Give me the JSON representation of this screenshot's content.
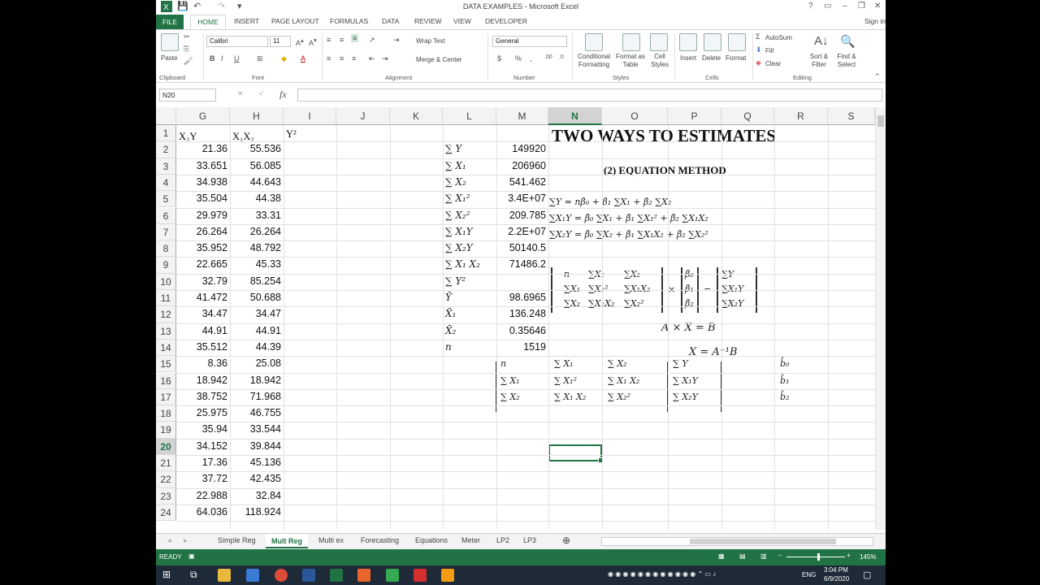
{
  "window": {
    "title": "DATA EXAMPLES - Microsoft Excel"
  },
  "menu_tabs": [
    "FILE",
    "HOME",
    "INSERT",
    "PAGE LAYOUT",
    "FORMULAS",
    "DATA",
    "REVIEW",
    "VIEW",
    "DEVELOPER"
  ],
  "signin": "Sign in",
  "ribbon": {
    "paste": "Paste",
    "font_name": "Calibri",
    "font_size": "11",
    "wrap_text": "Wrap Text",
    "merge_center": "Merge & Center",
    "number_format": "General",
    "cond_format": "Conditional Formatting",
    "format_table": "Format as Table",
    "cell_styles": "Cell Styles",
    "insert": "Insert",
    "delete": "Delete",
    "format": "Format",
    "autosum": "AutoSum",
    "fill": "Fill",
    "clear": "Clear",
    "sort_filter": "Sort & Filter",
    "find_select": "Find & Select",
    "groups": [
      "Clipboard",
      "Font",
      "Alignment",
      "Number",
      "Styles",
      "Cells",
      "Editing"
    ]
  },
  "namebox": "N20",
  "columns": [
    "G",
    "H",
    "I",
    "J",
    "K",
    "L",
    "M",
    "N",
    "O",
    "P",
    "Q",
    "R",
    "S"
  ],
  "selected_column": "N",
  "rows": [
    "1",
    "2",
    "3",
    "4",
    "5",
    "6",
    "7",
    "8",
    "9",
    "10",
    "11",
    "12",
    "13",
    "14",
    "15",
    "16",
    "17",
    "18",
    "19",
    "20",
    "21",
    "22",
    "23",
    "24"
  ],
  "selected_row": "20",
  "headers": {
    "g1": "X₂Y",
    "h1": "X₁X₂",
    "i1": "Y²"
  },
  "col_g": [
    "21.36",
    "33.651",
    "34.938",
    "35.504",
    "29.979",
    "26.264",
    "35.952",
    "22.665",
    "32.79",
    "41.472",
    "34.47",
    "44.91",
    "35.512",
    "8.36",
    "18.942",
    "38.752",
    "25.975",
    "35.94",
    "34.152",
    "17.36",
    "37.72",
    "22.988",
    "64.036"
  ],
  "col_h": [
    "55.536",
    "56.085",
    "44.643",
    "44.38",
    "33.31",
    "26.264",
    "48.792",
    "45.33",
    "85.254",
    "50.688",
    "34.47",
    "44.91",
    "44.39",
    "25.08",
    "18.942",
    "71.968",
    "46.755",
    "33.544",
    "39.844",
    "45.136",
    "42.435",
    "32.84",
    "118.924"
  ],
  "col_l": [
    "∑ Y",
    "∑ X₁",
    "∑ X₂",
    "∑ X₁²",
    "∑ X₂²",
    "∑ X₁Y",
    "∑ X₂Y",
    "∑ X₁ X₂",
    "∑ Y²",
    "Ȳ",
    "X̄₁",
    "X̄₂",
    "n"
  ],
  "col_m": [
    "149920",
    "206960",
    "541.462",
    "3.4E+07",
    "209.785",
    "2.2E+07",
    "50140.5",
    "71486.2",
    "",
    "98.6965",
    "136.248",
    "0.35646",
    "1519"
  ],
  "title": "TWO WAYS TO ESTIMATES",
  "subtitle": "(2) EQUATION METHOD",
  "equations": [
    "∑Y = nβ̂₀ + β̂₁ ∑X₁ + β̂₂ ∑X₂",
    "∑X₁Y = β̂₀ ∑X₁ + β̂₁ ∑X₁² + β̂₂ ∑X₁X₂",
    "∑X₂Y = β̂₀ ∑X₂ + β̂₁ ∑X₁X₂ + β̂₂ ∑X₂²"
  ],
  "matrix_a": [
    [
      "n",
      "∑X₁",
      "∑X₂"
    ],
    [
      "∑X₁",
      "∑X₁²",
      "∑X₁X₂"
    ],
    [
      "∑X₂",
      "∑X₁X₂",
      "∑X₂²"
    ]
  ],
  "vector_beta": [
    "β̂₀",
    "β̂₁",
    "β̂₂"
  ],
  "vector_b": [
    "∑Y",
    "∑X₁Y",
    "∑X₂Y"
  ],
  "times": "×",
  "equals": "=",
  "eq_axb": "A × X = B",
  "eq_inv": "X = A⁻¹B",
  "table_a": [
    [
      "n",
      "∑ X₁",
      "∑ X₂"
    ],
    [
      "∑ X₁",
      "∑ X₁²",
      "∑ X₁ X₂"
    ],
    [
      "∑ X₂",
      "∑ X₁ X₂",
      "∑ X₂²"
    ]
  ],
  "table_b": [
    "∑ Y",
    "∑ X₁Y",
    "∑ X₂Y"
  ],
  "table_b_hat": [
    "b̂₀",
    "b̂₁",
    "b̂₂"
  ],
  "sheet_tabs": [
    "Simple Reg",
    "Mult Reg",
    "Multi ex",
    "Forecasting",
    "Equations",
    "Meter",
    "LP2",
    "LP3"
  ],
  "active_sheet": "Mult Reg",
  "status": {
    "ready": "READY",
    "zoom": "145%"
  },
  "taskbar": {
    "lang": "ENG",
    "time": "3:04 PM",
    "date": "6/9/2020"
  }
}
